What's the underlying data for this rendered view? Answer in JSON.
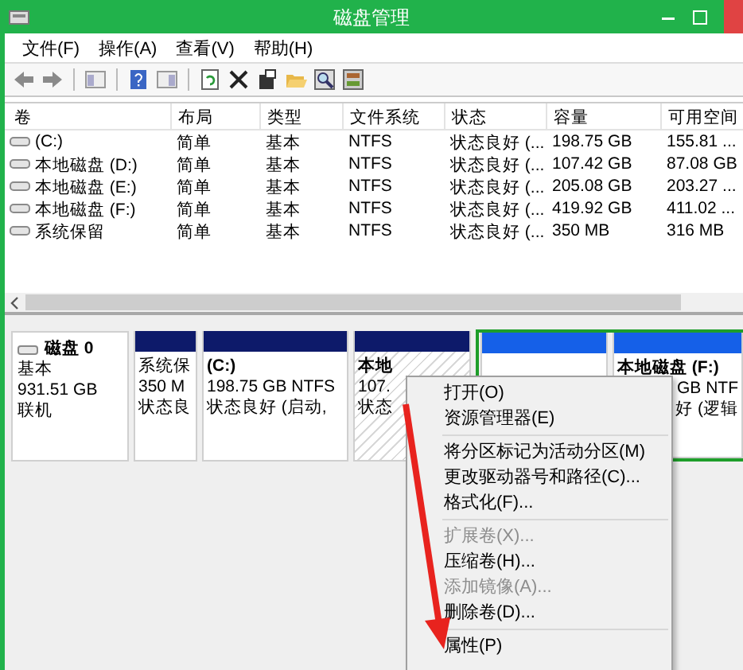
{
  "window": {
    "title": "磁盘管理"
  },
  "menu_bar": [
    "文件(F)",
    "操作(A)",
    "查看(V)",
    "帮助(H)"
  ],
  "volume_table": {
    "columns": [
      "卷",
      "布局",
      "类型",
      "文件系统",
      "状态",
      "容量",
      "可用空间"
    ],
    "rows": [
      {
        "volume": "(C:)",
        "layout": "简单",
        "type": "基本",
        "file_system": "NTFS",
        "status": "状态良好 (...",
        "capacity": "198.75 GB",
        "free_space": "155.81 ..."
      },
      {
        "volume": "本地磁盘 (D:)",
        "layout": "简单",
        "type": "基本",
        "file_system": "NTFS",
        "status": "状态良好 (...",
        "capacity": "107.42 GB",
        "free_space": "87.08 GB"
      },
      {
        "volume": "本地磁盘 (E:)",
        "layout": "简单",
        "type": "基本",
        "file_system": "NTFS",
        "status": "状态良好 (...",
        "capacity": "205.08 GB",
        "free_space": "203.27 ..."
      },
      {
        "volume": "本地磁盘 (F:)",
        "layout": "简单",
        "type": "基本",
        "file_system": "NTFS",
        "status": "状态良好 (...",
        "capacity": "419.92 GB",
        "free_space": "411.02 ..."
      },
      {
        "volume": "系统保留",
        "layout": "简单",
        "type": "基本",
        "file_system": "NTFS",
        "status": "状态良好 (...",
        "capacity": "350 MB",
        "free_space": "316 MB"
      }
    ]
  },
  "disk": {
    "name": "磁盘 0",
    "type": "基本",
    "size": "931.51 GB",
    "status": "联机",
    "partitions": [
      {
        "kind": "primary",
        "selected": false,
        "lines": [
          "系统保",
          "350 M",
          "状态良"
        ]
      },
      {
        "kind": "primary",
        "selected": false,
        "lines": [
          "(C:)",
          "198.75 GB NTFS",
          "状态良好 (启动,"
        ]
      },
      {
        "kind": "primary",
        "selected": true,
        "lines": [
          "本地",
          "107.",
          "状态"
        ]
      },
      {
        "kind": "logical",
        "selected": false
      },
      {
        "kind": "logical",
        "selected": false,
        "lines": [
          "本地磁盘 (F:)",
          "GB NTF",
          "好 (逻辑"
        ]
      }
    ]
  },
  "context_menu": {
    "items": [
      {
        "kind": "item",
        "label": "打开(O)",
        "disabled": false
      },
      {
        "kind": "item",
        "label": "资源管理器(E)",
        "disabled": false
      },
      {
        "kind": "separator"
      },
      {
        "kind": "item",
        "label": "将分区标记为活动分区(M)",
        "disabled": false
      },
      {
        "kind": "item",
        "label": "更改驱动器号和路径(C)...",
        "disabled": false
      },
      {
        "kind": "item",
        "label": "格式化(F)...",
        "disabled": false
      },
      {
        "kind": "separator"
      },
      {
        "kind": "item",
        "label": "扩展卷(X)...",
        "disabled": true
      },
      {
        "kind": "item",
        "label": "压缩卷(H)...",
        "disabled": false
      },
      {
        "kind": "item",
        "label": "添加镜像(A)...",
        "disabled": true
      },
      {
        "kind": "item",
        "label": "删除卷(D)...",
        "disabled": false
      },
      {
        "kind": "separator"
      },
      {
        "kind": "item",
        "label": "属性(P)",
        "disabled": false
      }
    ]
  }
}
